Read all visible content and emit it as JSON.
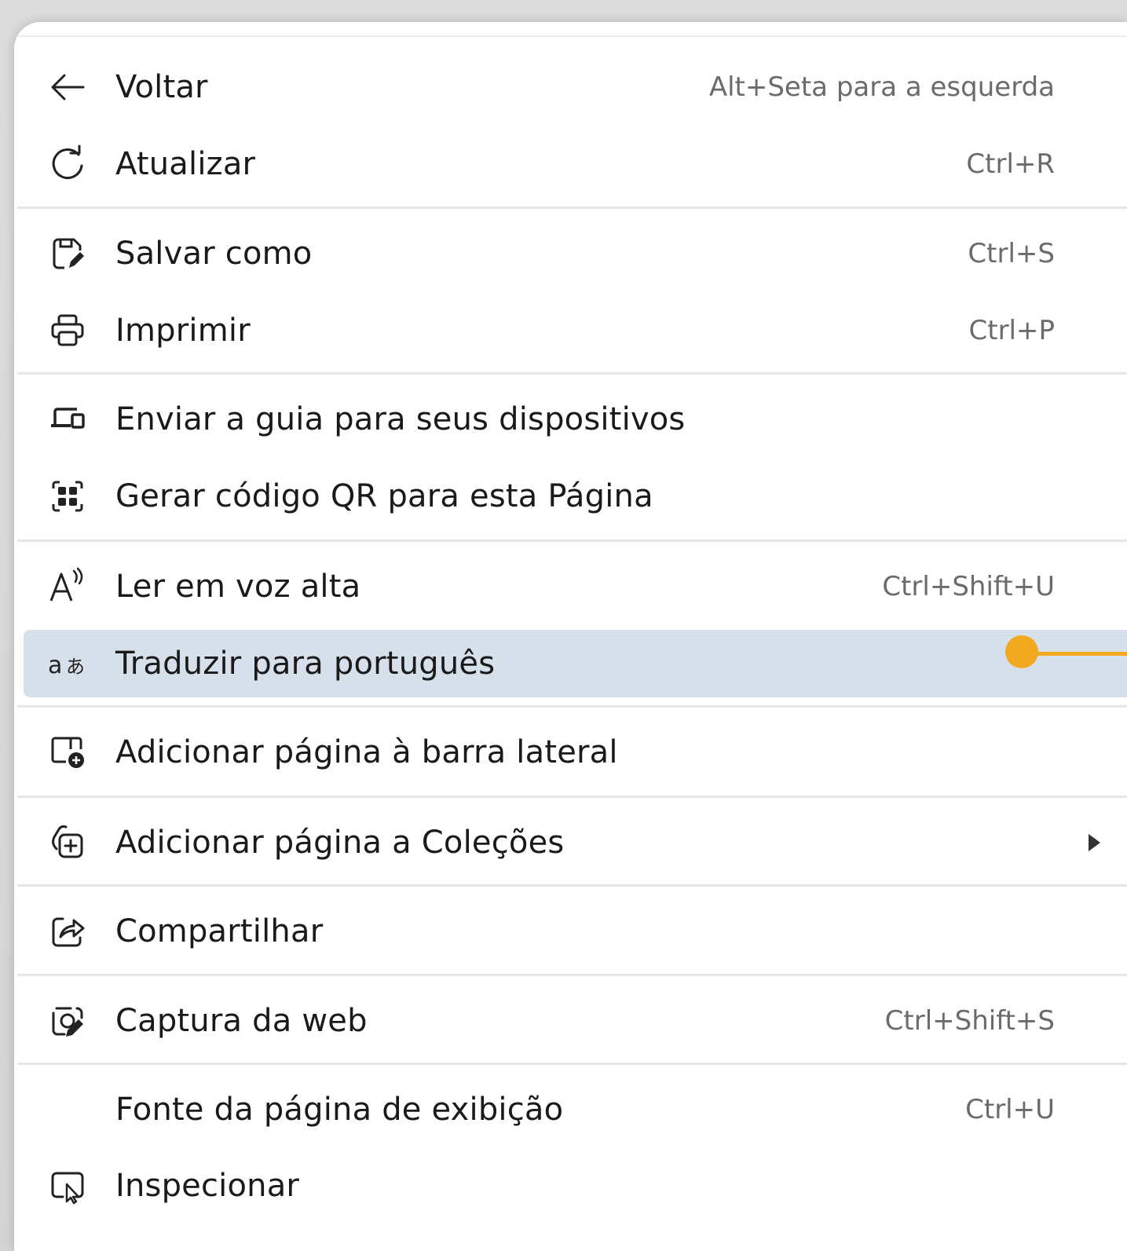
{
  "menu": {
    "items": [
      {
        "label": "Voltar",
        "shortcut": "Alt+Seta para a esquerda",
        "icon": "arrow-left-icon"
      },
      {
        "label": "Atualizar",
        "shortcut": "Ctrl+R",
        "icon": "refresh-icon"
      },
      {
        "label": "Salvar como",
        "shortcut": "Ctrl+S",
        "icon": "save-as-icon"
      },
      {
        "label": "Imprimir",
        "shortcut": "Ctrl+P",
        "icon": "printer-icon"
      },
      {
        "label": "Enviar a guia para seus dispositivos",
        "shortcut": "",
        "icon": "devices-icon"
      },
      {
        "label": "Gerar código QR para esta Página",
        "shortcut": "",
        "icon": "qr-code-icon"
      },
      {
        "label": "Ler em voz alta",
        "shortcut": "Ctrl+Shift+U",
        "icon": "read-aloud-icon"
      },
      {
        "label": "Traduzir para português",
        "shortcut": "",
        "icon": "translate-icon",
        "highlighted": true
      },
      {
        "label": "Adicionar página à barra lateral",
        "shortcut": "",
        "icon": "add-to-sidebar-icon"
      },
      {
        "label": "Adicionar página a Coleções",
        "shortcut": "",
        "icon": "collections-add-icon",
        "submenu": true
      },
      {
        "label": "Compartilhar",
        "shortcut": "",
        "icon": "share-icon"
      },
      {
        "label": "Captura da web",
        "shortcut": "Ctrl+Shift+S",
        "icon": "web-capture-icon"
      },
      {
        "label": "Fonte da página de exibição",
        "shortcut": "Ctrl+U",
        "icon": ""
      },
      {
        "label": "Inspecionar",
        "shortcut": "",
        "icon": "inspect-icon"
      }
    ]
  },
  "colors": {
    "highlight": "#d6e0ea",
    "callout": "#f3a91f",
    "shortcut_text": "#6b6b6b",
    "label_text": "#1a1a1a"
  }
}
